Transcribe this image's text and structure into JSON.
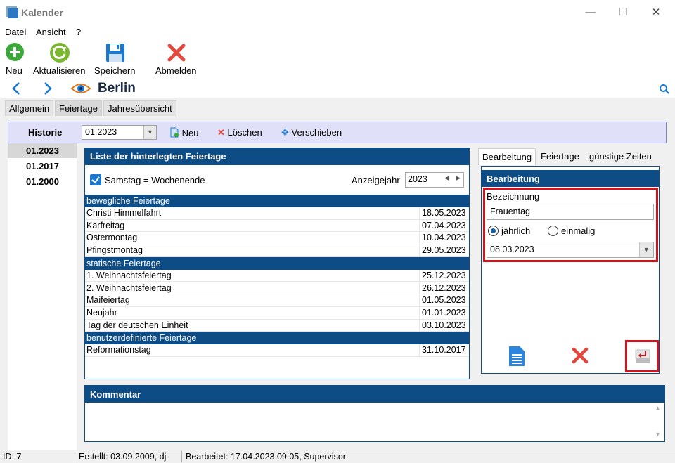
{
  "window": {
    "title": "Kalender",
    "minimize": "—",
    "maximize": "☐",
    "close": "✕"
  },
  "menu": [
    "Datei",
    "Ansicht",
    "?"
  ],
  "toolbar": {
    "new": "Neu",
    "refresh": "Aktualisieren",
    "save": "Speichern",
    "logout": "Abmelden"
  },
  "nav": {
    "location": "Berlin"
  },
  "tabs": [
    "Allgemein",
    "Feiertage",
    "Jahresübersicht"
  ],
  "history": {
    "label": "Historie",
    "selected": "01.2023",
    "actions": {
      "new": "Neu",
      "delete": "Löschen",
      "move": "Verschieben"
    },
    "items": [
      "01.2023",
      "01.2017",
      "01.2000"
    ]
  },
  "holidays": {
    "title": "Liste der hinterlegten Feiertage",
    "weekend_checkbox": "Samstag = Wochenende",
    "year_label": "Anzeigejahr",
    "year": "2023",
    "groups": [
      {
        "name": "bewegliche Feiertage",
        "rows": [
          {
            "name": "Christi Himmelfahrt",
            "date": "18.05.2023"
          },
          {
            "name": "Karfreitag",
            "date": "07.04.2023"
          },
          {
            "name": "Ostermontag",
            "date": "10.04.2023"
          },
          {
            "name": "Pfingstmontag",
            "date": "29.05.2023"
          }
        ]
      },
      {
        "name": "statische Feiertage",
        "rows": [
          {
            "name": "1. Weihnachtsfeiertag",
            "date": "25.12.2023"
          },
          {
            "name": "2. Weihnachtsfeiertag",
            "date": "26.12.2023"
          },
          {
            "name": "Maifeiertag",
            "date": "01.05.2023"
          },
          {
            "name": "Neujahr",
            "date": "01.01.2023"
          },
          {
            "name": "Tag der deutschen Einheit",
            "date": "03.10.2023"
          }
        ]
      },
      {
        "name": "benutzerdefinierte Feiertage",
        "rows": [
          {
            "name": "Reformationstag",
            "date": "31.10.2017"
          }
        ]
      }
    ]
  },
  "editor": {
    "tabs": [
      "Bearbeitung",
      "Feiertage",
      "günstige Zeiten"
    ],
    "title": "Bearbeitung",
    "field_label": "Bezeichnung",
    "field_value": "Frauentag",
    "radio_yearly": "jährlich",
    "radio_once": "einmalig",
    "date_value": "08.03.2023"
  },
  "comment": {
    "title": "Kommentar"
  },
  "status": {
    "id": "ID: 7",
    "created": "Erstellt: 03.09.2009, dj",
    "edited": "Bearbeitet: 17.04.2023 09:05, Supervisor"
  },
  "colors": {
    "header_blue": "#0e4c86",
    "highlight_red": "#d4121c",
    "accent_blue": "#1b78d0",
    "toolbar_green": "#3aa93a"
  }
}
